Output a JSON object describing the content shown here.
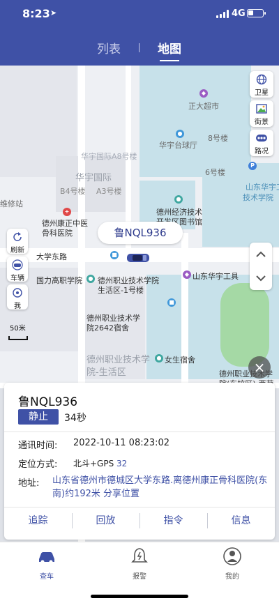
{
  "status_bar": {
    "time": "8:23",
    "network": "4G"
  },
  "tabs": [
    {
      "label": "列表",
      "active": false
    },
    {
      "label": "地图",
      "active": true
    }
  ],
  "map": {
    "labels": {
      "zhengda": "正大超市",
      "bldg8": "8号楼",
      "huayu_a8": "华宇国际A8号楼",
      "huayu_plaza": "华宇台球厅",
      "bldg6": "6号楼",
      "huayu_intl": "华宇国际",
      "b4": "B4号楼",
      "a3": "A3号楼",
      "shandong_huayu": "山东华宇工程",
      "tech_college": "技术学院",
      "weixiu": "维修站",
      "tcm_hospital": "德州康正中医骨科医院",
      "econ_lib": "德州经济技术开发区图书馆",
      "daxue_road": "大学东路",
      "guoli": "国力高职学院",
      "vocational_1": "德州职业技术学院生活区-1号楼",
      "huayu_tools": "山东华宇工具",
      "dorm_2642": "德州职业技术学院2642宿舍",
      "vocational_living": "德州职业技术学院-生活区",
      "female_dorm": "女生宿舍",
      "vocational_east": "德州职业技术学院(东校区)-西苑宿舍"
    },
    "controls": {
      "satellite": "卫星",
      "street_view": "街景",
      "traffic": "路况",
      "refresh": "刷新",
      "vehicle": "车辆",
      "me": "我"
    },
    "scale_label": "50米",
    "car_bubble": "鲁NQL936"
  },
  "panel": {
    "plate": "鲁NQL936",
    "status": "静止",
    "duration": "34秒",
    "comm_time_label": "通讯时间:",
    "comm_time_value": "2022-10-11 08:23:02",
    "positioning_label": "定位方式:",
    "positioning_value": "北斗+GPS",
    "positioning_count": "32",
    "address_label": "地址:",
    "address_value": "山东省德州市德城区大学东路.离德州康正骨科医院(东南)约192米",
    "share_label": "分享位置",
    "actions": [
      "追踪",
      "回放",
      "指令",
      "信息"
    ]
  },
  "bottom_nav": [
    {
      "label": "查车",
      "active": true
    },
    {
      "label": "报警",
      "active": false
    },
    {
      "label": "我的",
      "active": false
    }
  ],
  "colors": {
    "brand": "#3f51a6",
    "park_green": "#a5d9a5",
    "building_blue": "#c7e1ea"
  }
}
